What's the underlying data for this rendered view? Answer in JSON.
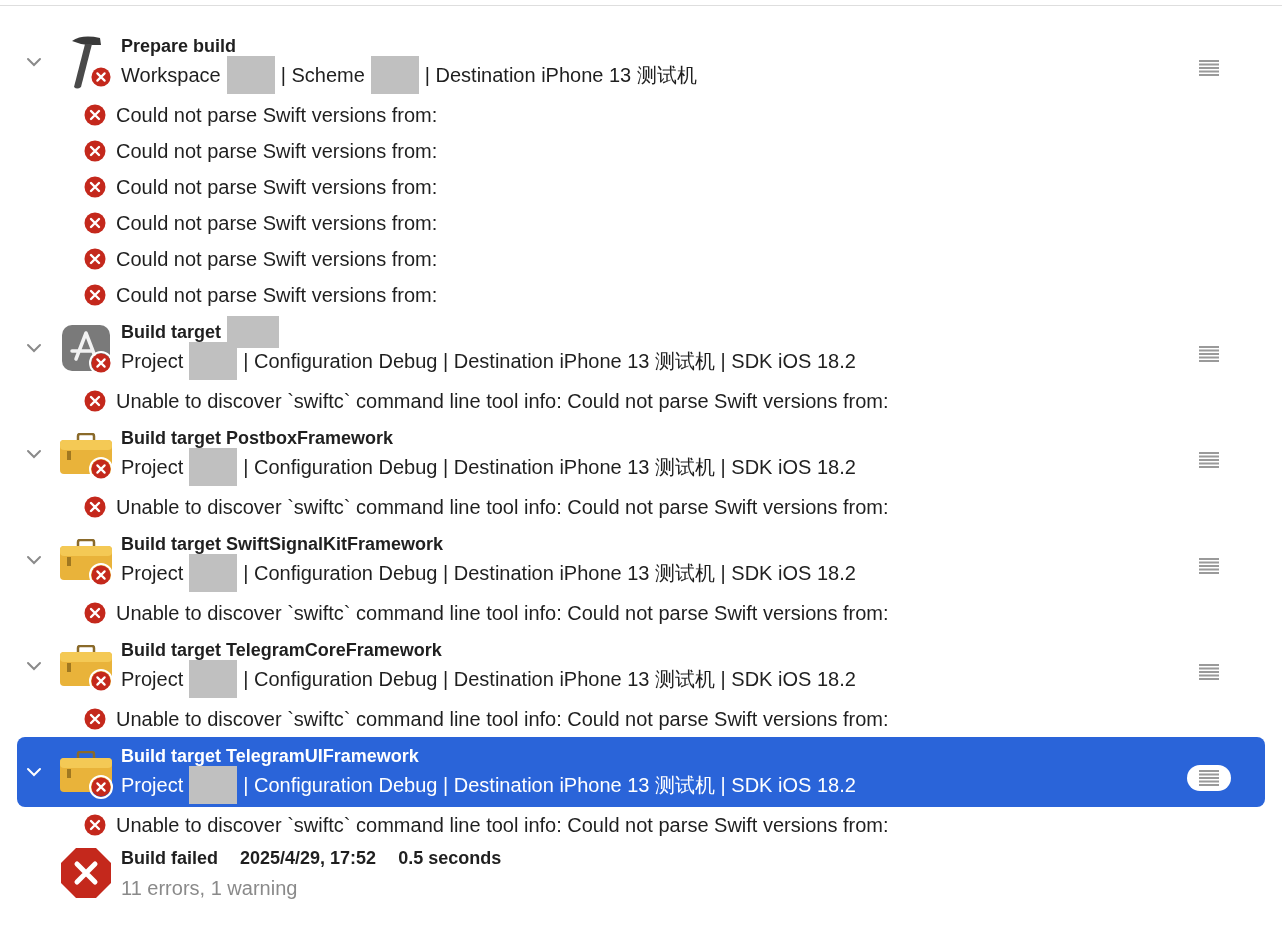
{
  "groups": [
    {
      "kind": "hammer",
      "expanded": true,
      "selected": false,
      "title": [
        {
          "kind": "text",
          "text": "Prepare build"
        }
      ],
      "details": [
        {
          "kind": "text",
          "text": "Workspace"
        },
        {
          "kind": "redacted"
        },
        {
          "kind": "text",
          "text": "| Scheme"
        },
        {
          "kind": "redacted"
        },
        {
          "kind": "text",
          "text": "| Destination iPhone 13 测试机"
        }
      ],
      "issues": [
        "Could not parse Swift versions from:",
        "Could not parse Swift versions from:",
        "Could not parse Swift versions from:",
        "Could not parse Swift versions from:",
        "Could not parse Swift versions from:",
        "Could not parse Swift versions from:"
      ]
    },
    {
      "kind": "app",
      "expanded": true,
      "selected": false,
      "title": [
        {
          "kind": "text",
          "text": "Build target"
        },
        {
          "kind": "redacted"
        }
      ],
      "details": [
        {
          "kind": "text",
          "text": "Project"
        },
        {
          "kind": "redacted"
        },
        {
          "kind": "text",
          "text": "| Configuration Debug | Destination iPhone 13 测试机 | SDK iOS 18.2"
        }
      ],
      "issues": [
        "Unable to discover `swiftc` command line tool info: Could not parse Swift versions from:"
      ]
    },
    {
      "kind": "toolbox",
      "expanded": true,
      "selected": false,
      "title": [
        {
          "kind": "text",
          "text": "Build target PostboxFramework"
        }
      ],
      "details": [
        {
          "kind": "text",
          "text": "Project"
        },
        {
          "kind": "redacted"
        },
        {
          "kind": "text",
          "text": "| Configuration Debug | Destination iPhone 13 测试机 | SDK iOS 18.2"
        }
      ],
      "issues": [
        "Unable to discover `swiftc` command line tool info: Could not parse Swift versions from:"
      ]
    },
    {
      "kind": "toolbox",
      "expanded": true,
      "selected": false,
      "title": [
        {
          "kind": "text",
          "text": "Build target SwiftSignalKitFramework"
        }
      ],
      "details": [
        {
          "kind": "text",
          "text": "Project"
        },
        {
          "kind": "redacted"
        },
        {
          "kind": "text",
          "text": "| Configuration Debug | Destination iPhone 13 测试机 | SDK iOS 18.2"
        }
      ],
      "issues": [
        "Unable to discover `swiftc` command line tool info: Could not parse Swift versions from:"
      ]
    },
    {
      "kind": "toolbox",
      "expanded": true,
      "selected": false,
      "title": [
        {
          "kind": "text",
          "text": "Build target TelegramCoreFramework"
        }
      ],
      "details": [
        {
          "kind": "text",
          "text": "Project"
        },
        {
          "kind": "redacted"
        },
        {
          "kind": "text",
          "text": "| Configuration Debug | Destination iPhone 13 测试机 | SDK iOS 18.2"
        }
      ],
      "issues": [
        "Unable to discover `swiftc` command line tool info: Could not parse Swift versions from:"
      ]
    },
    {
      "kind": "toolbox",
      "expanded": true,
      "selected": true,
      "title": [
        {
          "kind": "text",
          "text": "Build target TelegramUIFramework"
        }
      ],
      "details": [
        {
          "kind": "text",
          "text": "Project"
        },
        {
          "kind": "redacted"
        },
        {
          "kind": "text",
          "text": "| Configuration Debug | Destination iPhone 13 测试机 | SDK iOS 18.2"
        }
      ],
      "issues": [
        "Unable to discover `swiftc` command line tool info: Could not parse Swift versions from:"
      ]
    }
  ],
  "summary": {
    "title": "Build failed",
    "date": "2025/4/29, 17:52",
    "duration": "0.5 seconds",
    "counts": "11 errors, 1 warning"
  }
}
